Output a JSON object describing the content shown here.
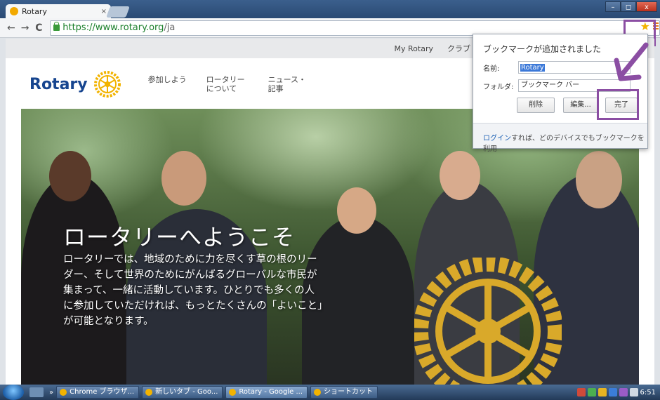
{
  "browser": {
    "tab_title": "Rotary",
    "tab_close": "×",
    "url_host": "https://www.rotary.org",
    "url_path": "/ja",
    "back": "←",
    "forward": "→",
    "reload": "C",
    "win_min": "–",
    "win_max": "◻",
    "win_close": "x"
  },
  "site": {
    "utility_links": [
      "My Rotary",
      "クラブ"
    ],
    "logo": "Rotary",
    "nav": [
      {
        "label": "参加しよう"
      },
      {
        "label": "ロータリー について"
      },
      {
        "label": "ニュース・ 記事"
      }
    ],
    "hero_title": "ロータリーへようこそ",
    "hero_body": "ロータリーでは、地域のために力を尽くす草の根のリーダー、そして世界のためにがんばるグローバルな市民が集まって、一緒に活動しています。ひとりでも多くの人に参加していただければ、もっとたくさんの「よいこと」が可能となります。"
  },
  "bookmark_bubble": {
    "title": "ブックマークが追加されました",
    "name_label": "名前:",
    "name_value": "Rotary",
    "folder_label": "フォルダ:",
    "folder_value": "ブックマーク バー",
    "delete_button": "削除",
    "edit_button": "編集...",
    "done_button": "完了",
    "footer_link": "ログイン",
    "footer_text": "すれば、どのデバイスでもブックマークを利用"
  },
  "taskbar": {
    "chevron": "»",
    "tasks": [
      "Chrome ブラウザ...",
      "新しいタブ - Goo...",
      "Rotary - Google ...",
      "ショートカット"
    ],
    "clock": "6:51"
  },
  "colors": {
    "accent_purple": "#8b4ea3",
    "rotary_blue": "#17458f",
    "rotary_gold": "#f2b300"
  }
}
